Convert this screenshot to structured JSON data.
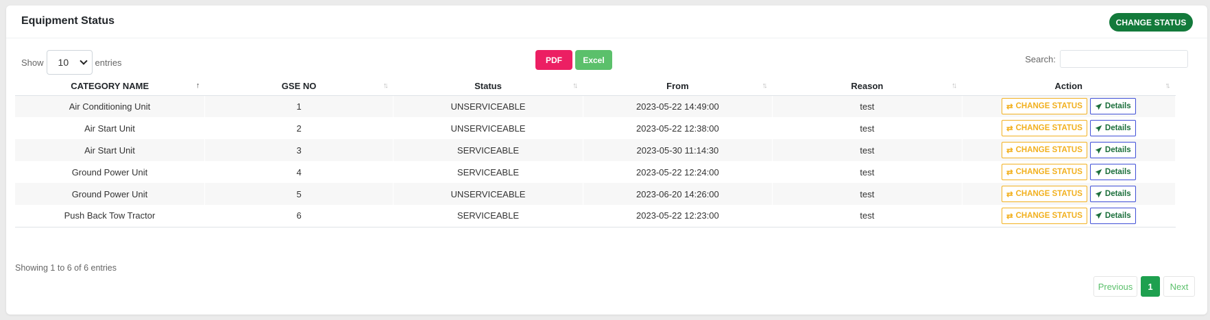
{
  "header": {
    "title": "Equipment Status",
    "change_status_label": "CHANGE STATUS"
  },
  "length": {
    "show": "Show",
    "value": "10",
    "entries": "entries"
  },
  "export": {
    "pdf": "PDF",
    "excel": "Excel"
  },
  "search": {
    "label": "Search:",
    "value": ""
  },
  "table": {
    "columns": [
      "CATEGORY NAME",
      "GSE NO",
      "Status",
      "From",
      "Reason",
      "Action"
    ],
    "rows": [
      {
        "category": "Air Conditioning Unit",
        "gse": "1",
        "status": "UNSERVICEABLE",
        "from": "2023-05-22 14:49:00",
        "reason": "test"
      },
      {
        "category": "Air Start Unit",
        "gse": "2",
        "status": "UNSERVICEABLE",
        "from": "2023-05-22 12:38:00",
        "reason": "test"
      },
      {
        "category": "Air Start Unit",
        "gse": "3",
        "status": "SERVICEABLE",
        "from": "2023-05-30 11:14:30",
        "reason": "test"
      },
      {
        "category": "Ground Power Unit",
        "gse": "4",
        "status": "SERVICEABLE",
        "from": "2023-05-22 12:24:00",
        "reason": "test"
      },
      {
        "category": "Ground Power Unit",
        "gse": "5",
        "status": "UNSERVICEABLE",
        "from": "2023-06-20 14:26:00",
        "reason": "test"
      },
      {
        "category": "Push Back Tow Tractor",
        "gse": "6",
        "status": "SERVICEABLE",
        "from": "2023-05-22 12:23:00",
        "reason": "test"
      }
    ],
    "action_change_label": "CHANGE STATUS",
    "action_details_label": "Details"
  },
  "footer": {
    "info": "Showing 1 to 6 of 6 entries",
    "previous": "Previous",
    "page": "1",
    "next": "Next"
  },
  "colors": {
    "primary": "#137a3b",
    "warning": "#f2b01e",
    "pdf": "#ec1f63",
    "excel": "#5bc06b"
  }
}
